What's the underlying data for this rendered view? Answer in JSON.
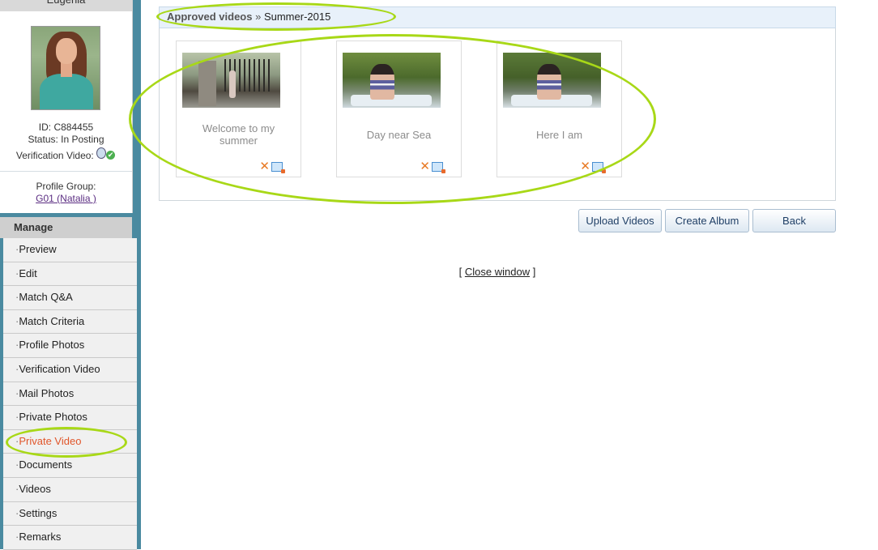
{
  "profile": {
    "name": "Eugenia",
    "id_line": "ID: C884455",
    "status_line": "Status: In Posting",
    "verification_label": "Verification Video:",
    "group_label": "Profile Group:",
    "group_link": "G01 (Natalia )"
  },
  "manage": {
    "title": "Manage",
    "items": [
      {
        "label": "Preview"
      },
      {
        "label": "Edit"
      },
      {
        "label": "Match Q&A"
      },
      {
        "label": "Match Criteria"
      },
      {
        "label": "Profile Photos"
      },
      {
        "label": "Verification Video"
      },
      {
        "label": "Mail Photos"
      },
      {
        "label": "Private Photos"
      },
      {
        "label": "Private Video",
        "active": true
      },
      {
        "label": "Documents"
      },
      {
        "label": "Videos"
      },
      {
        "label": "Settings"
      },
      {
        "label": "Remarks"
      }
    ]
  },
  "breadcrumb": {
    "root": "Approved videos",
    "separator": "»",
    "current": "Summer-2015"
  },
  "videos": [
    {
      "title": "Welcome to my summer"
    },
    {
      "title": "Day near Sea"
    },
    {
      "title": "Here I am"
    }
  ],
  "actions": {
    "upload": "Upload Videos",
    "create_album": "Create Album",
    "back": "Back"
  },
  "footer": {
    "open_bracket": "[",
    "close_window": "Close window",
    "close_bracket": "]"
  },
  "colors": {
    "highlight_ring": "#a8d817",
    "active_menu": "#e1562b",
    "sidebar_bg": "#4a8aa0"
  }
}
